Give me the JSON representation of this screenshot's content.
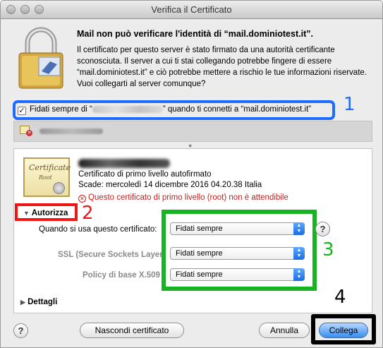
{
  "window": {
    "title": "Verifica il Certificato"
  },
  "heading": "Mail non può verificare l'identità di “mail.dominiotest.it”.",
  "body_text": "Il certificato per questo server è stato firmato da una autorità certificante sconosciuta. Il server a cui ti stai collegando potrebbe fingere di essere “mail.dominiotest.it” e ciò potrebbe mettere a rischio le tue informazioni riservate. Vuoi collegarti al server comunque?",
  "trust_checkbox": {
    "checked": true,
    "label_prefix": "Fidati sempre di “",
    "label_suffix": "” quando ti connetti a “mail.dominiotest.it”"
  },
  "annotations": {
    "n1": "1",
    "n2": "2",
    "n3": "3",
    "n4": "4"
  },
  "certificate": {
    "type_line": "Certificato di primo livello autofirmato",
    "expiry_line": "Scade: mercoledì 14 dicembre 2016 04.20.38 Italia",
    "warning_line": "Questo certificato di primo livello (root) non è attendibile",
    "icon_text": "Certificate",
    "icon_subtext": "Root"
  },
  "trust_section": {
    "label": "Autorizza",
    "rows": [
      {
        "label": "Quando si usa questo certificato:",
        "value": "Fidati sempre"
      },
      {
        "label": "SSL (Secure Sockets Layer)",
        "value": "Fidati sempre"
      },
      {
        "label": "Policy di base X.509",
        "value": "Fidati sempre"
      }
    ]
  },
  "details_label": "Dettagli",
  "buttons": {
    "help": "?",
    "show_cert": "Nascondi certificato",
    "cancel": "Annulla",
    "connect": "Collega"
  },
  "colors": {
    "annotation_blue": "#1f6bff",
    "annotation_red": "#f01616",
    "annotation_green": "#17b421",
    "annotation_black": "#000000",
    "warning": "#c81e1e"
  }
}
